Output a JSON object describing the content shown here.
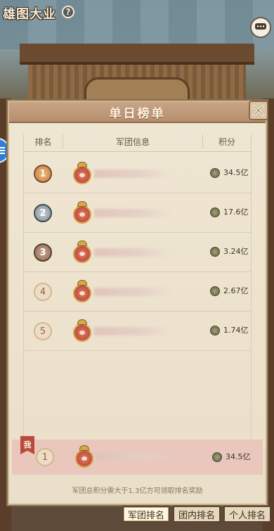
{
  "game": {
    "title": "雄图大业"
  },
  "panel": {
    "title": "单日榜单",
    "columns": {
      "rank": "排名",
      "info": "军团信息",
      "score": "积分"
    }
  },
  "rows": [
    {
      "rank": "1",
      "score": "34.5亿",
      "medal": "gold"
    },
    {
      "rank": "2",
      "score": "17.6亿",
      "medal": "silver"
    },
    {
      "rank": "3",
      "score": "3.24亿",
      "medal": "bronze"
    },
    {
      "rank": "4",
      "score": "2.67亿",
      "medal": "plain"
    },
    {
      "rank": "5",
      "score": "1.74亿",
      "medal": "plain"
    }
  ],
  "my_row": {
    "tag": "我",
    "rank": "1",
    "score": "34.5亿"
  },
  "footer_note": "军团总积分需大于1.3亿方可领取排名奖励",
  "tabs": [
    {
      "label": "军团排名",
      "active": true
    },
    {
      "label": "团内排名",
      "active": false
    },
    {
      "label": "个人排名",
      "active": false
    }
  ]
}
